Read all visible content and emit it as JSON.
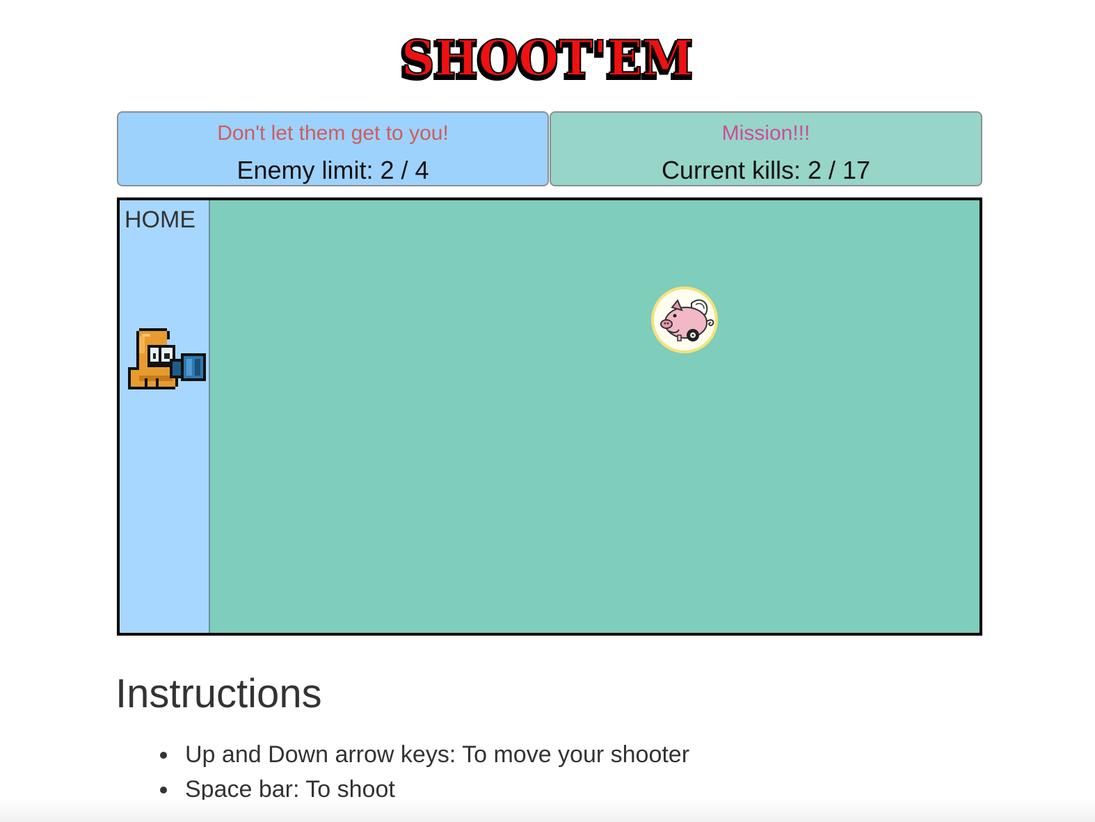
{
  "title": "SHOOT'EM",
  "colors": {
    "logo_fill": "#ee1111",
    "enemy_limit_bg": "#9dd2fd",
    "mission_bg": "#96d5c8",
    "field_bg": "#7fcdbb",
    "home_bg": "#a7d7fe"
  },
  "enemy_panel": {
    "subtitle": "Don't let them get to you!",
    "stat": "Enemy limit: 2 / 4"
  },
  "mission_panel": {
    "subtitle": "Mission!!!",
    "stat": "Current kills: 2 / 17"
  },
  "field": {
    "home_label": "HOME",
    "shooter_icon": "orange-blob-shooter-icon",
    "enemy_icon": "flying-pig-icon"
  },
  "instructions": {
    "heading": "Instructions",
    "items": [
      "Up and Down arrow keys: To move your shooter",
      "Space bar: To shoot"
    ]
  }
}
